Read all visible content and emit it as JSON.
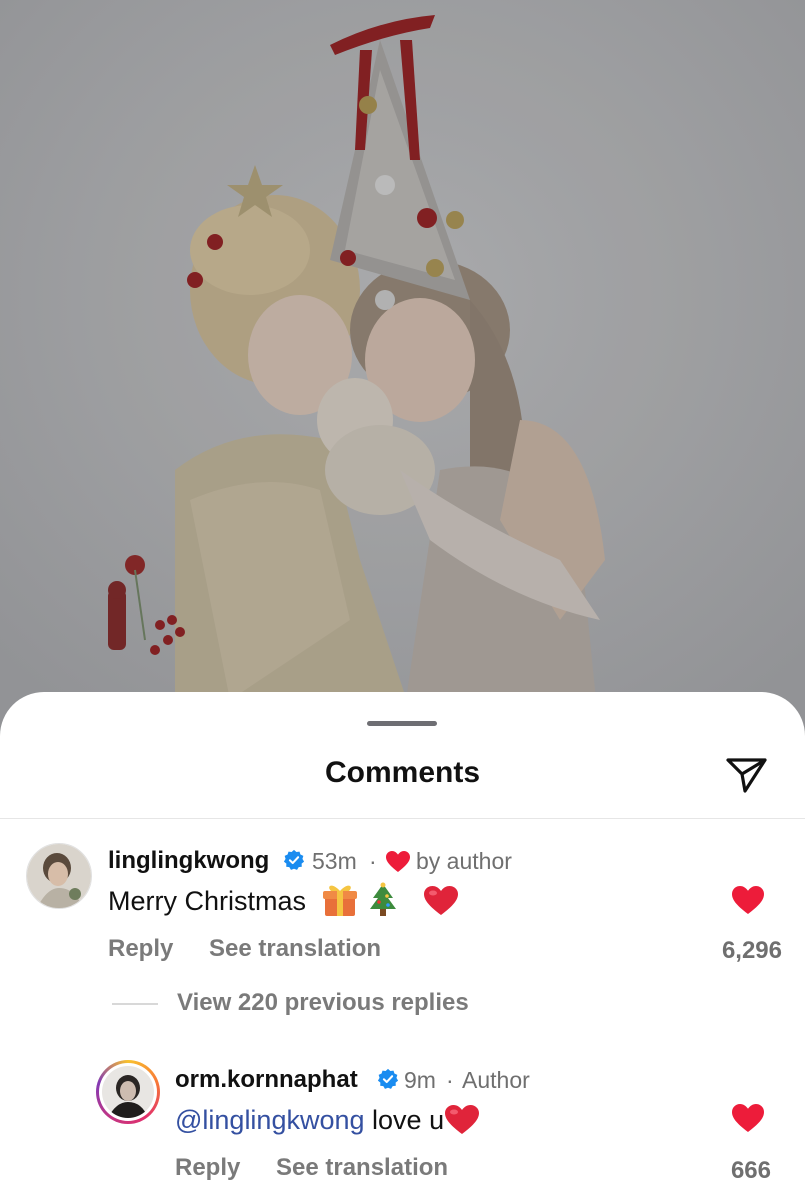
{
  "sheet": {
    "title": "Comments",
    "send_icon": "paper-plane-icon"
  },
  "colors": {
    "heart_red": "#ed1c3a",
    "mention_blue": "#3450a1",
    "verified_blue": "#1a8cf0"
  },
  "comments": [
    {
      "username": "linglingkwong",
      "verified": true,
      "time": "53m",
      "separator": "·",
      "badge": "by author",
      "text": "Merry Christmas",
      "emojis": [
        "gift",
        "christmas-tree",
        "red-heart"
      ],
      "reply_label": "Reply",
      "translate_label": "See translation",
      "like_count": "6,296",
      "liked": true
    },
    {
      "username": "orm.kornnaphat",
      "verified": true,
      "time": "9m",
      "separator": "·",
      "badge": "Author",
      "mention": "@linglingkwong",
      "text": "love u",
      "emojis": [
        "red-heart"
      ],
      "reply_label": "Reply",
      "translate_label": "See translation",
      "like_count": "666",
      "liked": true
    }
  ],
  "view_replies_label": "View 220 previous replies"
}
